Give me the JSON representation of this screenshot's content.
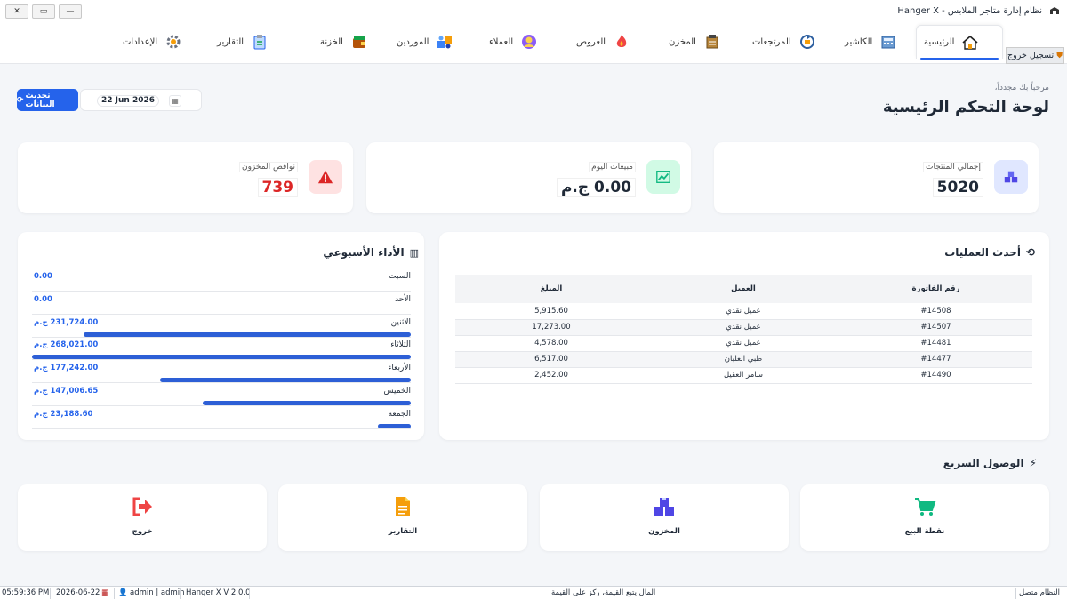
{
  "window": {
    "title": "نظام إدارة متاجر الملابس - Hanger X",
    "close": "✕",
    "restore": "▭",
    "minimize": "—"
  },
  "ribbon": {
    "tabs": [
      {
        "label": "الرئيسية",
        "icon": "home-icon"
      },
      {
        "label": "الكاشير",
        "icon": "cash-register-icon"
      },
      {
        "label": "المرتجعات",
        "icon": "returns-icon"
      },
      {
        "label": "المخزن",
        "icon": "warehouse-icon"
      },
      {
        "label": "العروض",
        "icon": "fire-icon"
      },
      {
        "label": "العملاء",
        "icon": "customer-icon"
      },
      {
        "label": "الموردين",
        "icon": "suppliers-icon"
      },
      {
        "label": "الخزنة",
        "icon": "wallet-icon"
      },
      {
        "label": "التقارير",
        "icon": "clipboard-icon"
      },
      {
        "label": "الإعدادات",
        "icon": "gear-icon"
      }
    ],
    "logout_label": "تسجيل خروج"
  },
  "header": {
    "welcome": "مرحباً بك مجدداً،",
    "title": "لوحة التحكم الرئيسية",
    "date": "22 Jun 2026",
    "refresh_label": "تحديث البيانات"
  },
  "stats": {
    "total_products_label": "إجمالي المنتجات",
    "total_products_value": "5020",
    "today_sales_label": "مبيعات اليوم",
    "today_sales_value": "0.00 ج.م",
    "stock_shortage_label": "نواقص المخزون",
    "stock_shortage_value": "739",
    "accent_blue": "#2563eb",
    "accent_green": "#10b981",
    "accent_red": "#dc2626"
  },
  "transactions": {
    "title": "أحدث العمليات",
    "columns": [
      "رقم الفاتورة",
      "العميل",
      "المبلغ"
    ],
    "rows": [
      {
        "invoice": "#14508",
        "customer": "عميل نقدي",
        "amount": "5,915.60"
      },
      {
        "invoice": "#14507",
        "customer": "عميل نقدي",
        "amount": "17,273.00"
      },
      {
        "invoice": "#14481",
        "customer": "عميل نقدي",
        "amount": "4,578.00"
      },
      {
        "invoice": "#14477",
        "customer": "طبي العلبان",
        "amount": "6,517.00"
      },
      {
        "invoice": "#14490",
        "customer": "سامر العقيل",
        "amount": "2,452.00"
      }
    ]
  },
  "weekly": {
    "title": "الأداء الأسبوعي",
    "days": [
      {
        "day": "السبت",
        "amount": "0.00",
        "fraction": 0
      },
      {
        "day": "الأحد",
        "amount": "0.00",
        "fraction": 0
      },
      {
        "day": "الاثنين",
        "amount": "231,724.00 ج.م",
        "fraction": 0.8646
      },
      {
        "day": "الثلاثاء",
        "amount": "268,021.00 ج.م",
        "fraction": 1
      },
      {
        "day": "الأربعاء",
        "amount": "177,242.00 ج.م",
        "fraction": 0.6613
      },
      {
        "day": "الخميس",
        "amount": "147,006.65 ج.م",
        "fraction": 0.5485
      },
      {
        "day": "الجمعة",
        "amount": "23,188.60 ج.م",
        "fraction": 0.0865
      }
    ]
  },
  "quick_access": {
    "title": "الوصول السريع",
    "items": [
      {
        "label": "نقطة البيع",
        "icon": "cart-icon",
        "color": "#10b981"
      },
      {
        "label": "المخزون",
        "icon": "boxes-icon",
        "color": "#4f46e5"
      },
      {
        "label": "التقارير",
        "icon": "document-icon",
        "color": "#f59e0b"
      },
      {
        "label": "خروج",
        "icon": "exit-icon",
        "color": "#ef4444"
      }
    ]
  },
  "statusbar": {
    "connection": "النظام متصل",
    "slogan": "المال يتبع القيمة، ركز على القيمة",
    "version": "Hanger X V 2.0.0",
    "user": "admin | admin",
    "date": "2026-06-22",
    "time": "05:59:36 PM"
  }
}
